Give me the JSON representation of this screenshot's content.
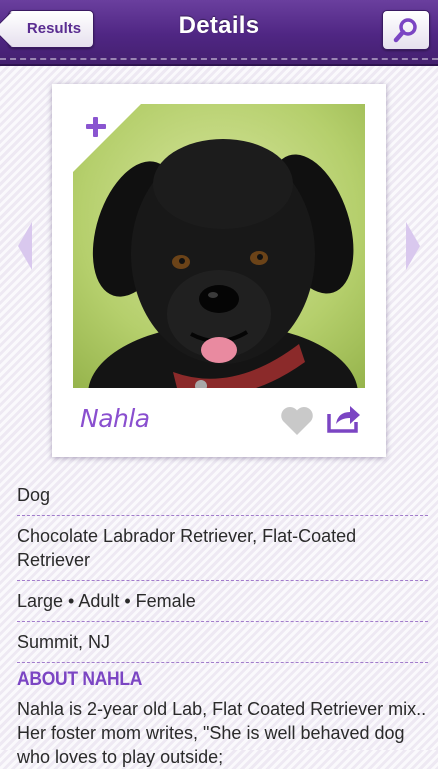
{
  "navbar": {
    "back_label": "Results",
    "title": "Details"
  },
  "card": {
    "pet_name": "Nahla"
  },
  "details": {
    "species": "Dog",
    "breeds": "Chocolate Labrador Retriever, Flat-Coated Retriever",
    "attributes": "Large • Adult • Female",
    "location": "Summit, NJ"
  },
  "about": {
    "heading": "ABOUT NAHLA",
    "text": "Nahla is 2-year old Lab, Flat Coated Retriever mix.. Her foster mom writes, \"She is well behaved dog who loves to play outside;"
  },
  "colors": {
    "brand_purple": "#4f2683",
    "accent_purple": "#8a4fcf"
  }
}
